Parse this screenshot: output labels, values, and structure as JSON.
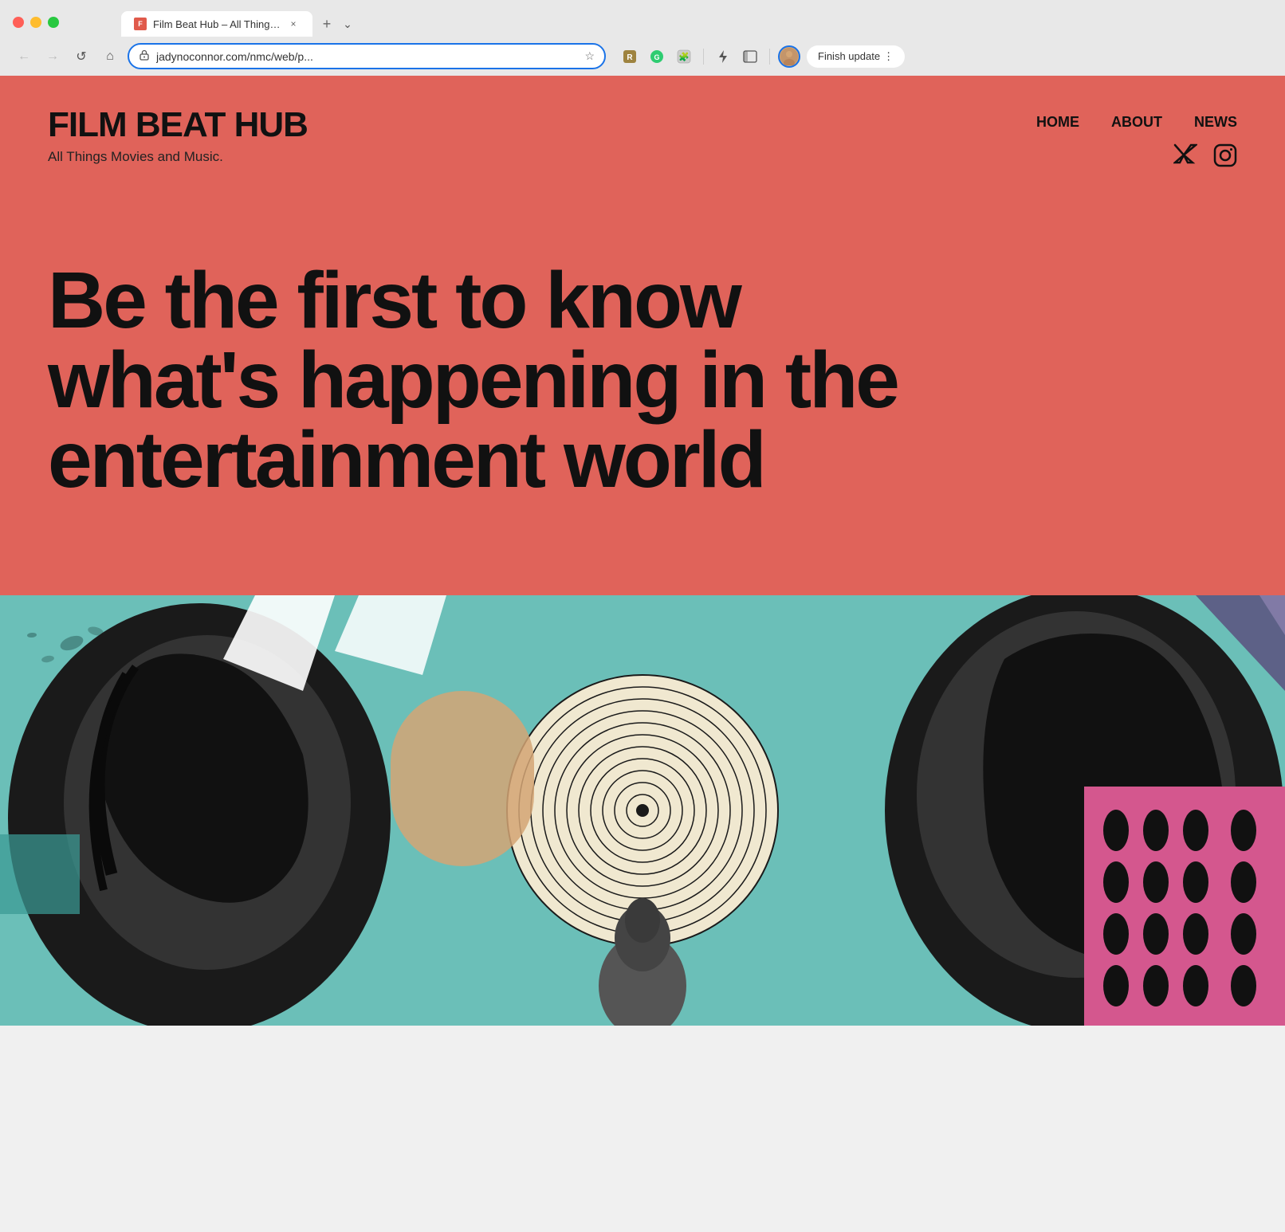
{
  "browser": {
    "tab": {
      "favicon_text": "F",
      "title": "Film Beat Hub – All Things M...",
      "close_label": "×"
    },
    "new_tab_label": "+",
    "menu_label": "⌄",
    "nav": {
      "back_label": "←",
      "forward_label": "→",
      "reload_label": "↺",
      "home_label": "⌂"
    },
    "address_bar": {
      "secure_icon": "⊙",
      "url": "jadynoconnor.com/nmc/web/p...",
      "star_icon": "☆"
    },
    "extensions": [
      {
        "name": "ext-1",
        "icon": "⚡"
      },
      {
        "name": "ext-2",
        "icon": "🤖"
      },
      {
        "name": "ext-3",
        "icon": "🧩"
      }
    ],
    "divider_visible": true,
    "bolt_icon": "⚡",
    "sidebar_icon": "▤",
    "finish_update": {
      "label": "Finish update",
      "menu_icon": "⋮"
    }
  },
  "site": {
    "brand": {
      "title": "FILM BEAT HUB",
      "tagline": "All Things Movies and Music."
    },
    "nav": {
      "items": [
        {
          "label": "HOME"
        },
        {
          "label": "ABOUT"
        },
        {
          "label": "NEWS"
        }
      ]
    },
    "social": {
      "twitter_icon": "𝕏",
      "instagram_icon": "◎"
    },
    "hero": {
      "headline": "Be the first to know what's happening in the entertainment world"
    }
  },
  "colors": {
    "site_bg": "#e0635a",
    "teal_bg": "#6bbfb8",
    "pink_block": "#d4578e",
    "text_dark": "#111111"
  }
}
